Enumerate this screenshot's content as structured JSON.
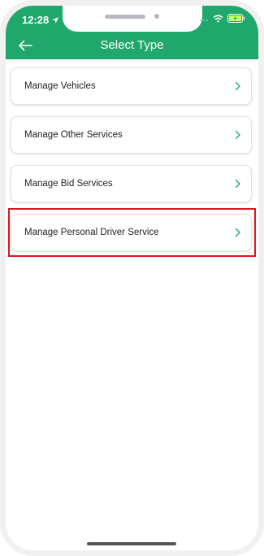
{
  "status_bar": {
    "time": "12:28"
  },
  "header": {
    "title": "Select Type"
  },
  "menu": {
    "items": [
      {
        "label": "Manage Vehicles"
      },
      {
        "label": "Manage Other Services"
      },
      {
        "label": "Manage Bid Services"
      },
      {
        "label": "Manage Personal Driver Service",
        "highlighted": true
      }
    ]
  },
  "colors": {
    "accent": "#20a76c",
    "highlight": "#e0141e"
  },
  "icons": {
    "back": "arrow-left-icon",
    "item": "chevron-right-icon"
  }
}
